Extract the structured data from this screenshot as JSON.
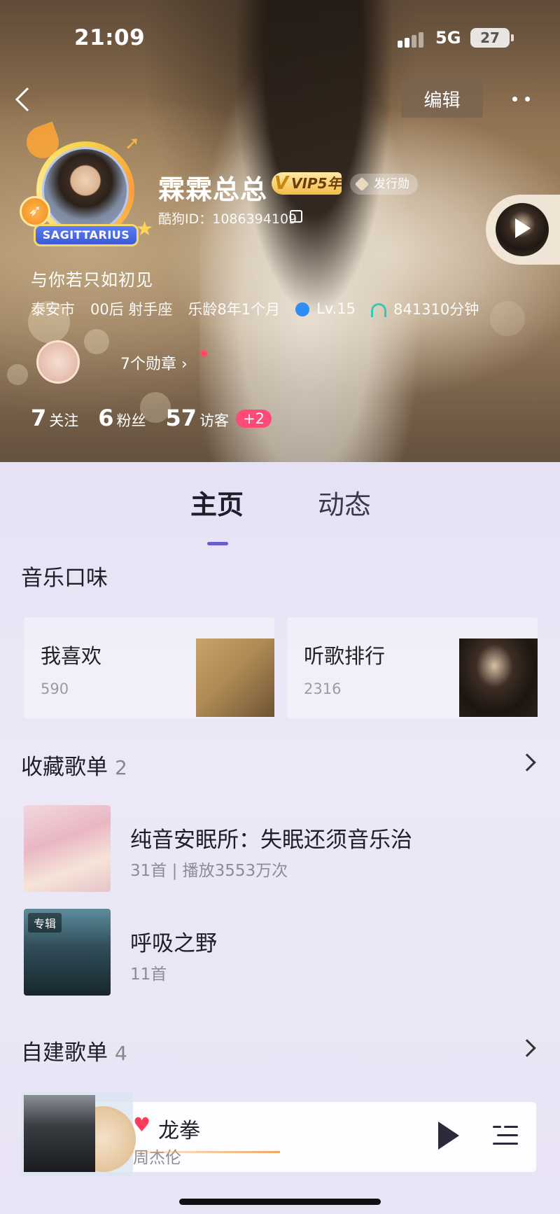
{
  "status": {
    "time": "21:09",
    "network": "5G",
    "battery": "27"
  },
  "header": {
    "edit_label": "编辑",
    "username": "霖霖总总",
    "vip_label": "VIP5年",
    "issuer_label": "发行勋",
    "zodiac_label": "SAGITTARIUS",
    "kugou_id": "酷狗ID：1086394109",
    "signature": "与你若只如初见",
    "city": "泰安市",
    "age_zodiac": "00后 射手座",
    "music_age": "乐龄8年1个月",
    "level": "Lv.15",
    "listen_time": "841310分钟",
    "medals": "7个勋章 ›",
    "stats": {
      "following_count": "7",
      "following_label": "关注",
      "fans_count": "6",
      "fans_label": "粉丝",
      "visitors_count": "57",
      "visitors_label": "访客",
      "visitors_new": "+2"
    }
  },
  "tabs": {
    "home": "主页",
    "dynamic": "动态"
  },
  "music_taste": {
    "title": "音乐口味",
    "cards": [
      {
        "title": "我喜欢",
        "count": "590"
      },
      {
        "title": "听歌排行",
        "count": "2316"
      }
    ]
  },
  "collected": {
    "title": "收藏歌单",
    "count": "2",
    "items": [
      {
        "title": "纯音安眠所：失眠还须音乐治",
        "subtitle": "31首 | 播放3553万次"
      },
      {
        "title": "呼吸之野",
        "subtitle": "11首",
        "tag": "专辑"
      }
    ]
  },
  "created": {
    "title": "自建歌单",
    "count": "4"
  },
  "player": {
    "title": "龙拳",
    "artist": "周杰伦",
    "progress": 0.27
  },
  "colors": {
    "accent": "#6a5cd3",
    "heart": "#ff3b5c",
    "badge_pink": "#ff4a78",
    "vip_gold": "#f1bc45"
  }
}
